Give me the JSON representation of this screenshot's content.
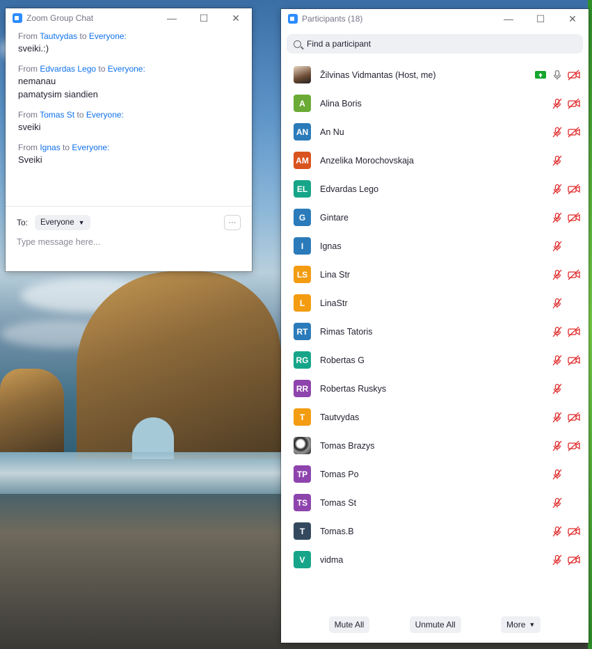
{
  "chat": {
    "title": "Zoom Group Chat",
    "messages": [
      {
        "from": "From",
        "sender": "Tautvydas",
        "to": "to",
        "recipient": "Everyone:",
        "lines": [
          "sveiki.:)"
        ]
      },
      {
        "from": "From",
        "sender": "Edvardas Lego",
        "to": "to",
        "recipient": "Everyone:",
        "lines": [
          "nemanau",
          "pamatysim siandien"
        ]
      },
      {
        "from": "From",
        "sender": "Tomas St",
        "to": "to",
        "recipient": "Everyone:",
        "lines": [
          "sveiki"
        ]
      },
      {
        "from": "From",
        "sender": "Ignas",
        "to": "to",
        "recipient": "Everyone:",
        "lines": [
          "Sveiki"
        ]
      }
    ],
    "to_label": "To:",
    "to_value": "Everyone",
    "more_label": "···",
    "placeholder": "Type message here..."
  },
  "participants": {
    "title": "Participants (18)",
    "search_placeholder": "Find a participant",
    "list": [
      {
        "initials": "",
        "name": "Žilvinas Vidmantas (Host, me)",
        "color": "photo",
        "share": true,
        "mic": "on",
        "video": "off"
      },
      {
        "initials": "A",
        "name": "Alina Boris",
        "color": "#6bab35",
        "mic": "off",
        "video": "off"
      },
      {
        "initials": "AN",
        "name": "An Nu",
        "color": "#2b7bba",
        "mic": "off",
        "video": "off"
      },
      {
        "initials": "AM",
        "name": "Anzelika Morochovskaja",
        "color": "#d9531e",
        "mic": "off",
        "video": "none"
      },
      {
        "initials": "EL",
        "name": "Edvardas Lego",
        "color": "#17a589",
        "mic": "off",
        "video": "off"
      },
      {
        "initials": "G",
        "name": "Gintare",
        "color": "#2b7bba",
        "mic": "off",
        "video": "off"
      },
      {
        "initials": "I",
        "name": "Ignas",
        "color": "#2b7bba",
        "mic": "off",
        "video": "none"
      },
      {
        "initials": "LS",
        "name": "Lina Str",
        "color": "#f39c12",
        "mic": "off",
        "video": "off"
      },
      {
        "initials": "L",
        "name": "LinaStr",
        "color": "#f39c12",
        "mic": "off",
        "video": "none"
      },
      {
        "initials": "RT",
        "name": "Rimas Tatoris",
        "color": "#2b7bba",
        "mic": "off",
        "video": "off"
      },
      {
        "initials": "RG",
        "name": "Robertas G",
        "color": "#17a589",
        "mic": "off",
        "video": "off"
      },
      {
        "initials": "RR",
        "name": "Robertas Ruskys",
        "color": "#8e44ad",
        "mic": "off",
        "video": "none"
      },
      {
        "initials": "T",
        "name": "Tautvydas",
        "color": "#f39c12",
        "mic": "off",
        "video": "off"
      },
      {
        "initials": "",
        "name": "Tomas Brazys",
        "color": "photo2",
        "mic": "off",
        "video": "off"
      },
      {
        "initials": "TP",
        "name": "Tomas Po",
        "color": "#8e44ad",
        "mic": "off",
        "video": "none"
      },
      {
        "initials": "TS",
        "name": "Tomas St",
        "color": "#8e44ad",
        "mic": "off",
        "video": "none"
      },
      {
        "initials": "T",
        "name": "Tomas.B",
        "color": "#34495e",
        "mic": "off",
        "video": "off"
      },
      {
        "initials": "V",
        "name": "vidma",
        "color": "#17a589",
        "mic": "off",
        "video": "off"
      }
    ],
    "mute_all": "Mute All",
    "unmute_all": "Unmute All",
    "more": "More"
  },
  "icons": {
    "mic_off": "muted-mic-icon",
    "video_off": "video-off-icon",
    "mic_on": "mic-icon",
    "share": "screen-share-icon"
  },
  "colors": {
    "accent": "#0e71eb",
    "muted_red": "#e02828"
  }
}
